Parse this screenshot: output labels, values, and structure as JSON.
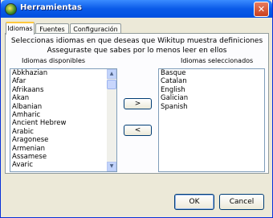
{
  "window": {
    "title": "Herramientas",
    "close_glyph": "✕",
    "app_icon": "wikitup-icon"
  },
  "tabs": [
    {
      "label": "Idiomas",
      "active": true
    },
    {
      "label": "Fuentes",
      "active": false
    },
    {
      "label": "Configuración",
      "active": false
    }
  ],
  "idiomas": {
    "instruction_line1": "Seleccionas idiomas en que deseas que Wikitup muestra definiciones",
    "instruction_line2": "Asseguraste que sabes por lo menos leer en ellos",
    "available_label": "Idiomas disponibles",
    "selected_label": "Idiomas seleccionados",
    "available": [
      "Abkhazian",
      "Afar",
      "Afrikaans",
      "Akan",
      "Albanian",
      "Amharic",
      "Ancient Hebrew",
      "Arabic",
      "Aragonese",
      "Armenian",
      "Assamese",
      "Avaric"
    ],
    "selected": [
      "Basque",
      "Catalan",
      "English",
      "Galician",
      "Spanish"
    ],
    "add_label": ">",
    "remove_label": "<",
    "scroll_up_glyph": "▲",
    "scroll_down_glyph": "▼"
  },
  "footer": {
    "ok_label": "OK",
    "cancel_label": "Cancel"
  }
}
